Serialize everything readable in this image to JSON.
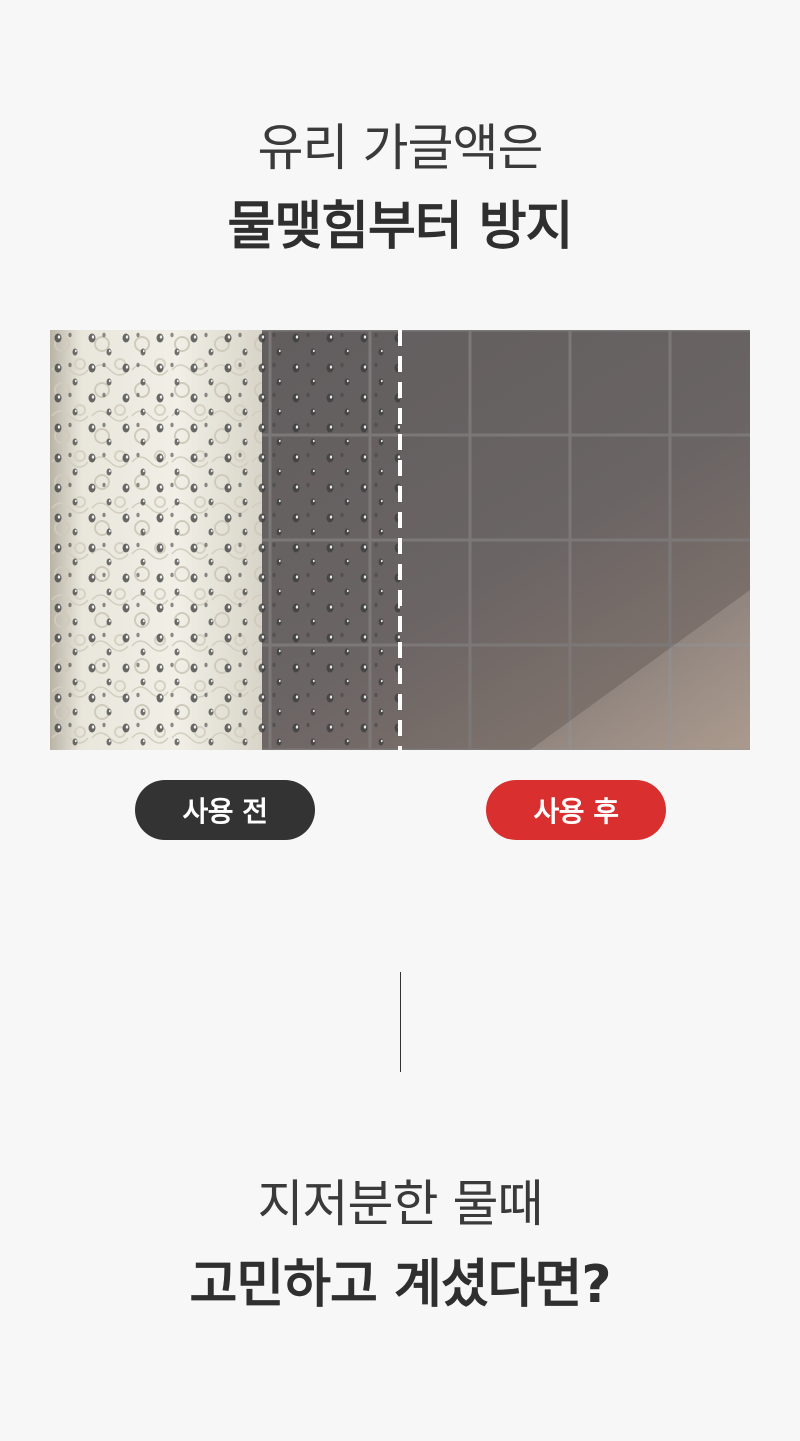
{
  "section1": {
    "line1": "유리 가글액은",
    "line2": "물맺힘부터 방지"
  },
  "comparison": {
    "before_label": "사용 전",
    "after_label": "사용 후",
    "colors": {
      "before_badge": "#333333",
      "after_badge": "#d9302f"
    }
  },
  "section2": {
    "line1": "지저분한 물때",
    "line2": "고민하고 계셨다면?"
  }
}
